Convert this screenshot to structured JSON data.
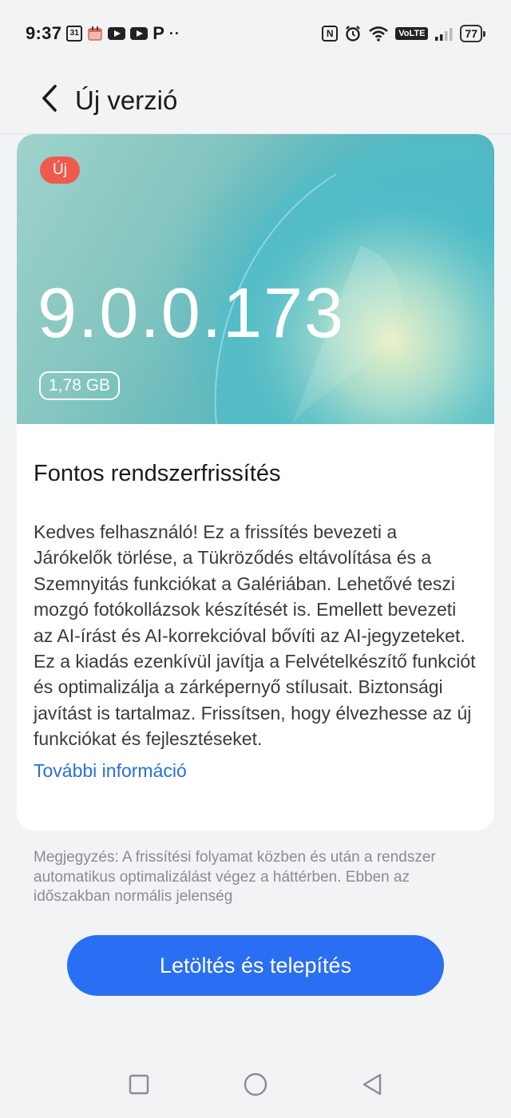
{
  "status_bar": {
    "time": "9:37",
    "calendar_day": "31",
    "battery_level": "77",
    "volte_label": "VoLTE",
    "icons": [
      "calendar-icon",
      "calendar-alt-icon",
      "youtube-icon",
      "youtube-icon",
      "p-app-icon",
      "more-dots-icon",
      "nfc-icon",
      "alarm-icon",
      "wifi-icon",
      "volte-icon",
      "signal-icon",
      "battery-icon"
    ]
  },
  "header": {
    "title": "Új verzió",
    "back_icon": "chevron-left-icon"
  },
  "banner": {
    "badge": "Új",
    "version": "9.0.0.173",
    "size": "1,78 GB"
  },
  "update": {
    "title": "Fontos rendszerfrissítés",
    "description": "Kedves felhasználó! Ez a frissítés bevezeti a Járókelők törlése, a Tükröződés eltávolítása és a Szemnyitás funkciókat a Galériában. Lehetővé teszi mozgó fotókollázsok készítését is. Emellett bevezeti az AI-írást és AI-korrekcióval bővíti az AI-jegyzeteket. Ez a kiadás ezenkívül javítja a Felvételkészítő funkciót és optimalizálja a zárképernyő stílusait. Biztonsági javítást is tartalmaz. Frissítsen, hogy élvezhesse az új funkciókat és fejlesztéseket.",
    "more_link": "További információ"
  },
  "note": {
    "text": "Megjegyzés: A frissítési folyamat közben és után a rendszer automatikus optimalizálást végez a háttérben. Ebben az időszakban normális jelenség"
  },
  "actions": {
    "download_install": "Letöltés és telepítés"
  },
  "nav_bar": {
    "icons": [
      "recents-square-icon",
      "home-circle-icon",
      "back-triangle-icon"
    ]
  },
  "colors": {
    "accent": "#2a6ff3",
    "link": "#2a6fd6",
    "badge": "#f05a4d",
    "background": "#f2f3f5",
    "card": "#ffffff"
  }
}
